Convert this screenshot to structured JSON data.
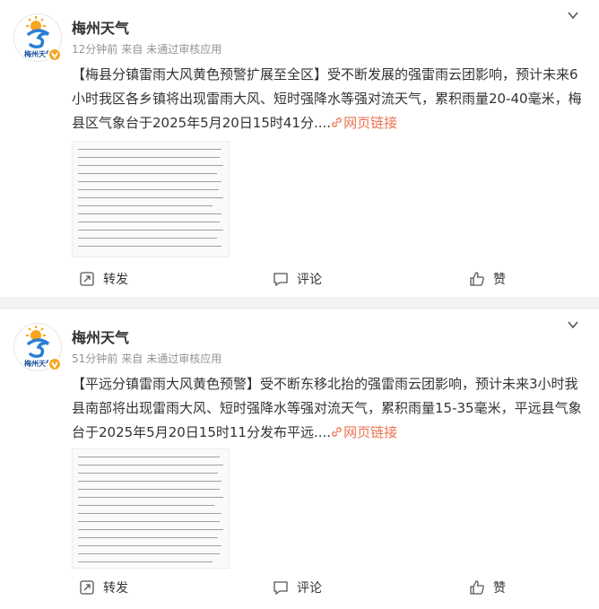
{
  "posts": [
    {
      "user": {
        "name": "梅州天气",
        "avatar_text": "梅州天气",
        "verified_color": "#f5a623"
      },
      "meta": {
        "time": "12分钟前",
        "source_prefix": "来自",
        "source": "未通过审核应用"
      },
      "text": {
        "body": "【梅县分镇雷雨大风黄色预警扩展至全区】受不断发展的强雷雨云团影响，预计未来6小时我区各乡镇将出现雷雨大风、短时强降水等强对流天气，累积雨量20-40毫米，梅县区气象台于2025年5月20日15时41分....",
        "link_label": "网页链接"
      },
      "actions": {
        "repost": "转发",
        "comment": "评论",
        "like": "赞"
      }
    },
    {
      "user": {
        "name": "梅州天气",
        "avatar_text": "梅州天气",
        "verified_color": "#f5a623"
      },
      "meta": {
        "time": "51分钟前",
        "source_prefix": "来自",
        "source": "未通过审核应用"
      },
      "text": {
        "body": "【平远分镇雷雨大风黄色预警】受不断东移北抬的强雷雨云团影响，预计未来3小时我县南部将出现雷雨大风、短时强降水等强对流天气，累积雨量15-35毫米，平远县气象台于2025年5月20日15时11分发布平远....",
        "link_label": "网页链接"
      },
      "actions": {
        "repost": "转发",
        "comment": "评论",
        "like": "赞"
      }
    }
  ],
  "colors": {
    "link": "#eb7350",
    "meta": "#939393",
    "text": "#333333",
    "background": "#f2f2f2"
  },
  "icons": [
    "chevron-down-icon",
    "link-icon",
    "repost-icon",
    "comment-icon",
    "like-icon",
    "verified-badge-icon"
  ]
}
